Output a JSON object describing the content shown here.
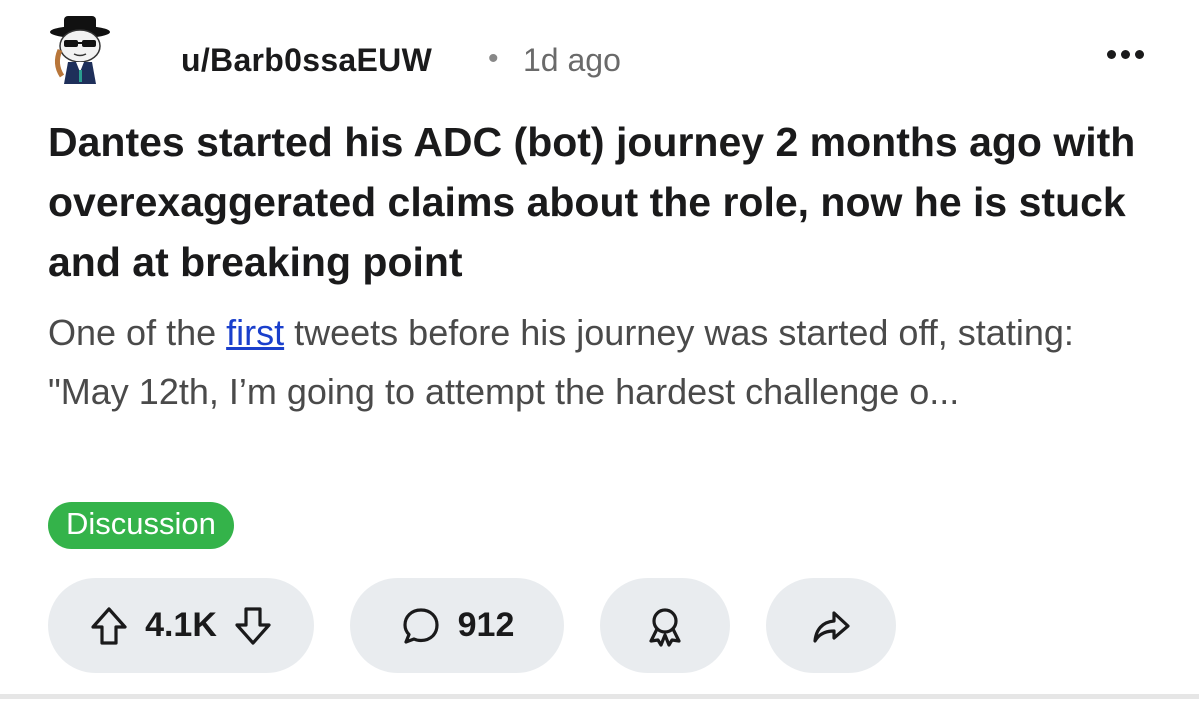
{
  "post": {
    "username": "u/Barb0ssaEUW",
    "separator": "•",
    "age": "1d ago",
    "title": "Dantes started his ADC (bot) journey 2 months ago with overexaggerated claims about the role, now he is stuck and at breaking point",
    "body": {
      "text_before": "One of the ",
      "link_text": "first",
      "text_after": " tweets before his journey was started off, stating:",
      "line2": "\"May 12th, I’m going to attempt the hardest challenge o..."
    },
    "flair": "Discussion",
    "icons": {
      "avatar": "user-avatar",
      "more": "more-options-icon",
      "upvote": "arrow-up-icon",
      "downvote": "arrow-down-icon",
      "comment": "comment-bubble-icon",
      "award": "award-ribbon-icon",
      "share": "share-arrow-icon"
    }
  },
  "actions": {
    "vote_count": "4.1K",
    "comment_count": "912"
  },
  "colors": {
    "flair_bg": "#34b34a",
    "link": "#1a3fcc",
    "pill_bg": "#e9ecef"
  }
}
